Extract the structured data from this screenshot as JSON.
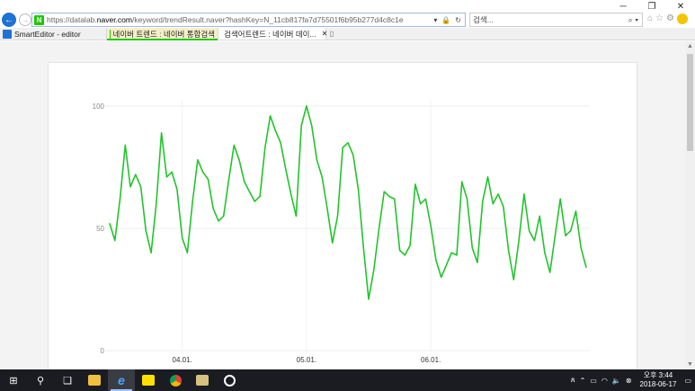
{
  "window": {
    "controls": [
      "_",
      "❐",
      "✕"
    ]
  },
  "addressbar": {
    "url_prefix": "https://datalab.",
    "url_domain": "naver.com",
    "url_suffix": "/keyword/trendResult.naver?hashKey=N_11cb817fa7d75501f6b95b277d4c8c1e",
    "search_placeholder": "검색..."
  },
  "tabs": [
    {
      "label": "SmartEditor - editor"
    },
    {
      "label": "네이버 트렌드 : 네이버 통합검색"
    },
    {
      "label": "검색어트렌드 : 네이버 데이..."
    }
  ],
  "colors": {
    "line": "#22c42b",
    "naver_green": "#1fc800",
    "ie_blue": "#1e72d2",
    "taskbar": "#1a1c22"
  },
  "chart_data": {
    "type": "line",
    "y_ticks": [
      "100",
      "50",
      "0"
    ],
    "ylim": [
      0,
      100
    ],
    "x_ticks": [
      {
        "label": "04.01.",
        "index": 14
      },
      {
        "label": "05.01.",
        "index": 38
      },
      {
        "label": "06.01.",
        "index": 62
      }
    ],
    "grid": true,
    "series": [
      {
        "values": [
          52,
          45,
          62,
          84,
          67,
          72,
          67,
          49,
          40,
          60,
          89,
          71,
          73,
          66,
          46,
          40,
          61,
          78,
          73,
          70,
          58,
          53,
          55,
          70,
          84,
          78,
          69,
          65,
          61,
          63,
          83,
          96,
          90,
          85,
          74,
          64,
          55,
          92,
          100,
          92,
          78,
          71,
          58,
          44,
          55,
          83,
          85,
          80,
          66,
          42,
          21,
          33,
          50,
          65,
          63,
          62,
          41,
          39,
          43,
          68,
          60,
          62,
          51,
          37,
          30,
          35,
          40,
          39,
          69,
          62,
          42,
          36,
          61,
          71,
          60,
          64,
          59,
          41,
          29,
          45,
          64,
          49,
          45,
          55,
          40,
          32,
          47,
          62,
          47,
          49,
          57,
          42,
          34
        ]
      }
    ]
  },
  "taskbar": {
    "clock_time": "오후 3:44",
    "clock_date": "2018-06-17"
  }
}
